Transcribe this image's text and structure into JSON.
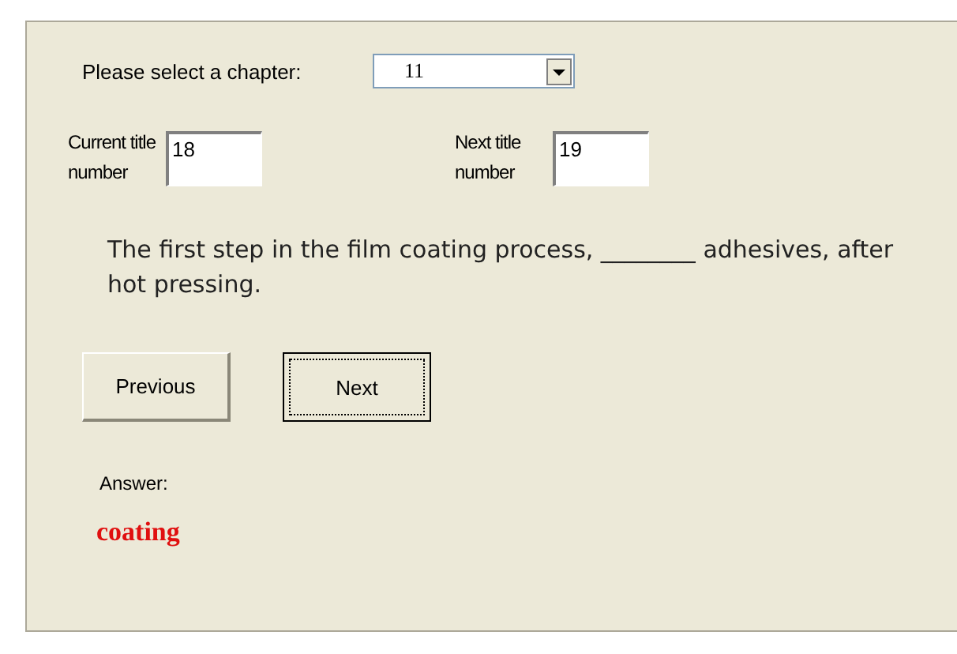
{
  "chapter_select": {
    "label": "Please select a chapter:",
    "value": "11"
  },
  "title_numbers": [
    {
      "label": "Current title number",
      "value": "18"
    },
    {
      "label": "Next title number",
      "value": "19"
    }
  ],
  "question": "The first step in the film coating process, ________ adhesives, after hot pressing.",
  "buttons": [
    {
      "label": "Previous",
      "focused": false
    },
    {
      "label": "Next",
      "focused": true
    }
  ],
  "answer": {
    "label": "Answer:",
    "value": "coating"
  }
}
